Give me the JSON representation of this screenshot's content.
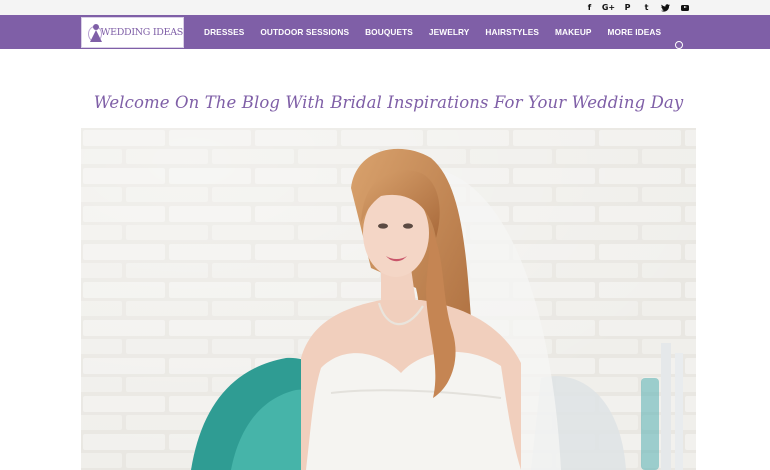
{
  "social_icons": [
    {
      "name": "facebook-icon",
      "glyph": "f"
    },
    {
      "name": "google-plus-icon",
      "glyph": "G+"
    },
    {
      "name": "pinterest-icon",
      "glyph": "P"
    },
    {
      "name": "tumblr-icon",
      "glyph": "t"
    },
    {
      "name": "twitter-icon",
      "glyph": "🐦"
    },
    {
      "name": "youtube-icon",
      "glyph": ""
    }
  ],
  "logo": {
    "text": "WEDDING IDEAS"
  },
  "nav": {
    "items": [
      "DRESSES",
      "OUTDOOR SESSIONS",
      "BOUQUETS",
      "JEWELRY",
      "HAIRSTYLES",
      "MAKEUP",
      "MORE IDEAS"
    ]
  },
  "search": {
    "icon": "search-icon"
  },
  "main": {
    "title": "Welcome On The Blog With Bridal Inspirations For Your Wedding Day"
  },
  "hero_image": {
    "subject": "bride-photo"
  },
  "colors": {
    "brand": "#7f5fa7",
    "topbar": "#f4f4f4",
    "background": "#ffffff"
  }
}
